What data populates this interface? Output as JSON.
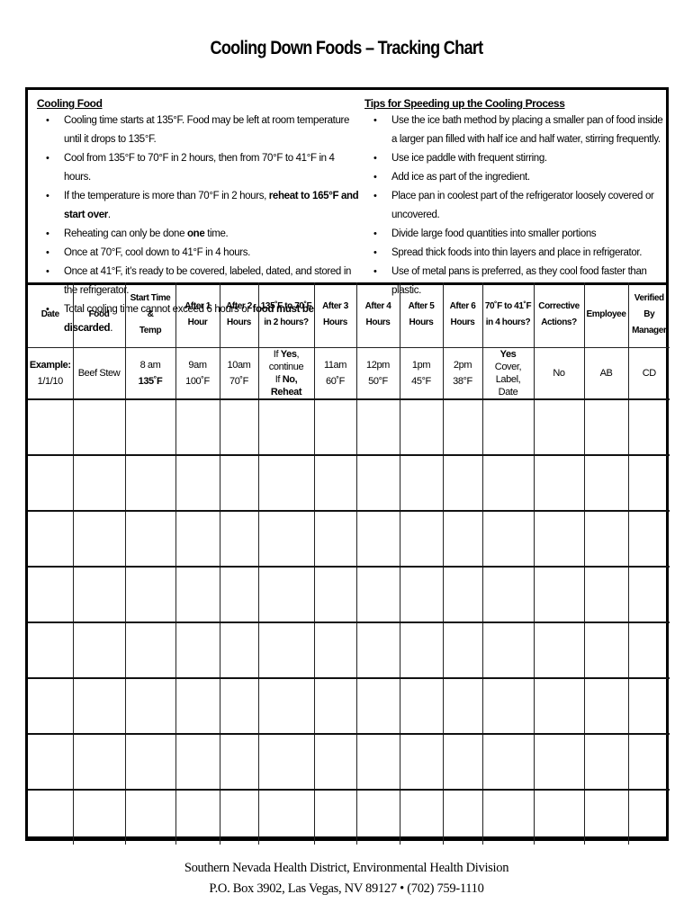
{
  "title": "Cooling Down Foods – Tracking Chart",
  "cooling_food": {
    "heading": "Cooling Food",
    "items": [
      {
        "pre": "Cooling time starts at 135°F. Food may be left at room temperature until it drops to 135°F.",
        "bold": "",
        "post": ""
      },
      {
        "pre": "Cool from 135°F to 70°F in 2 hours, then from 70°F to 41°F in 4 hours.",
        "bold": "",
        "post": ""
      },
      {
        "pre": "If the temperature is more than 70°F in 2 hours, ",
        "bold": "reheat to 165°F and start over",
        "post": "."
      },
      {
        "pre": "Reheating can only be done ",
        "bold": "one",
        "post": " time."
      },
      {
        "pre": "Once at 70°F, cool down to 41°F in 4 hours.",
        "bold": "",
        "post": ""
      },
      {
        "pre": "Once at 41°F, it’s ready to be covered, labeled, dated, and stored in the refrigerator.",
        "bold": "",
        "post": ""
      },
      {
        "pre": "Total cooling time cannot exceed 6 hours or ",
        "bold": "food must be discarded",
        "post": "."
      }
    ]
  },
  "tips": {
    "heading": "Tips for Speeding up the Cooling Process",
    "items": [
      "Use the ice bath method by placing a smaller pan of food inside a larger pan filled with half ice and half water, stirring frequently.",
      "Use ice paddle with frequent stirring.",
      "Add ice as part of the ingredient.",
      "Place pan in coolest part of the refrigerator loosely covered or uncovered.",
      "Divide large food quantities into smaller portions",
      "Spread thick foods into thin layers and place in refrigerator.",
      "Use of metal pans is preferred, as they cool food faster than plastic."
    ]
  },
  "table": {
    "headers": [
      [
        "Date"
      ],
      [
        "Food"
      ],
      [
        "Start Time",
        "&",
        "Temp"
      ],
      [
        "After 1",
        "Hour"
      ],
      [
        "After 2",
        "Hours"
      ],
      [
        "135˚F to 70˚F",
        "in 2 hours?"
      ],
      [
        "After 3",
        "Hours"
      ],
      [
        "After 4",
        "Hours"
      ],
      [
        "After 5",
        "Hours"
      ],
      [
        "After 6",
        "Hours"
      ],
      [
        "70˚F to 41˚F",
        "in 4 hours?"
      ],
      [
        "Corrective",
        "Actions?"
      ],
      [
        "Employee"
      ],
      [
        "Verified",
        "By",
        "Manager"
      ]
    ],
    "example": {
      "date": {
        "line1": "Example:",
        "line2": "1/1/10"
      },
      "food": "Beef Stew",
      "start": {
        "time": "8 am",
        "temp": "135˚F"
      },
      "after1": {
        "time": "9am",
        "temp": "100˚F"
      },
      "after2": {
        "time": "10am",
        "temp": "70˚F"
      },
      "check1": {
        "l1_pre": "If ",
        "l1_bold": "Yes",
        "l1_post": ",",
        "l2": "continue",
        "l3_pre": "If ",
        "l3_bold": "No",
        "l3_post": ", Reheat"
      },
      "after3": {
        "time": "11am",
        "temp": "60˚F"
      },
      "after4": {
        "time": "12pm",
        "temp": "50°F"
      },
      "after5": {
        "time": "1pm",
        "temp": "45°F"
      },
      "after6": {
        "time": "2pm",
        "temp": "38°F"
      },
      "check2": {
        "bold": "Yes",
        "l2": "Cover, Label,",
        "l3": "Date"
      },
      "corrective": "No",
      "employee": "AB",
      "verified": "CD"
    },
    "blank_rows": 8
  },
  "footer": {
    "line1": "Southern Nevada Health District, Environmental Health Division",
    "line2": "P.O. Box 3902, Las Vegas, NV 89127 • (702) 759-1110"
  }
}
